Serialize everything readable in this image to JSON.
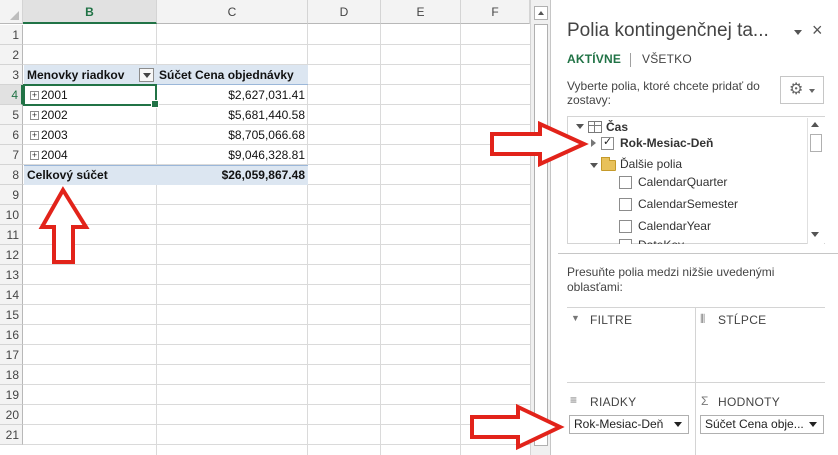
{
  "sheet": {
    "columns": [
      "B",
      "C",
      "D",
      "E",
      "F"
    ],
    "selected_column": "B",
    "rows": [
      "1",
      "2",
      "3",
      "4",
      "5",
      "6",
      "7",
      "8",
      "9",
      "10",
      "11",
      "12",
      "13",
      "14",
      "15",
      "16",
      "17",
      "18",
      "19",
      "20",
      "21"
    ],
    "selected_row": "4",
    "pivot": {
      "row_label_header": "Menovky riadkov",
      "value_header": "Súčet Cena objednávky",
      "rows": [
        {
          "label": "2001",
          "value": "$2,627,031.41"
        },
        {
          "label": "2002",
          "value": "$5,681,440.58"
        },
        {
          "label": "2003",
          "value": "$8,705,066.68"
        },
        {
          "label": "2004",
          "value": "$9,046,328.81"
        }
      ],
      "total_label": "Celkový súčet",
      "total_value": "$26,059,867.48"
    }
  },
  "pane": {
    "title": "Polia kontingenčnej ta...",
    "close": "×",
    "tabs": {
      "active": "AKTÍVNE",
      "all": "VŠETKO"
    },
    "instruction": "Vyberte polia, ktoré chcete pridať do zostavy:",
    "gear": "⚙",
    "fields": {
      "table": "Čas",
      "checked_field": "Rok-Mesiac-Deň",
      "folder": "Ďalšie polia",
      "items": [
        "CalendarQuarter",
        "CalendarSemester",
        "CalendarYear"
      ],
      "partial": "DateKey"
    },
    "drag_text": "Presuňte polia medzi nižšie uvedenými oblasťami:",
    "areas": {
      "filters": "FILTRE",
      "columns": "STĹPCE",
      "rows": "RIADKY",
      "values": "HODNOTY",
      "filter_icon": "▼",
      "columns_icon": "⦀",
      "rows_icon": "≡",
      "values_icon": "Σ"
    },
    "row_field": "Rok-Mesiac-Deň",
    "value_field": "Súčet Cena obje..."
  },
  "annotation": {
    "arrow_color": "#e2231a"
  }
}
